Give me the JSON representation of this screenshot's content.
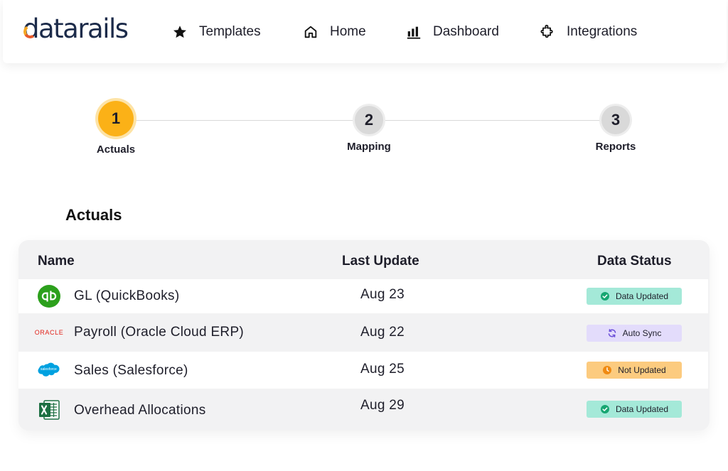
{
  "brand": {
    "logo_text": "datarails"
  },
  "nav": [
    {
      "label": "Templates",
      "icon": "star-icon"
    },
    {
      "label": "Home",
      "icon": "home-icon"
    },
    {
      "label": "Dashboard",
      "icon": "bar-chart-icon"
    },
    {
      "label": "Integrations",
      "icon": "puzzle-icon"
    }
  ],
  "stepper": [
    {
      "number": "1",
      "label": "Actuals",
      "state": "active"
    },
    {
      "number": "2",
      "label": "Mapping",
      "state": "pending"
    },
    {
      "number": "3",
      "label": "Reports",
      "state": "pending"
    }
  ],
  "section": {
    "title": "Actuals"
  },
  "table": {
    "headers": {
      "name": "Name",
      "last_update": "Last Update",
      "data_status": "Data Status"
    },
    "rows": [
      {
        "logo": "quickbooks-logo",
        "name": "GL (QuickBooks)",
        "last_update": "Aug 23",
        "status": "Data Updated",
        "status_color": "#a4e9d8",
        "status_icon": "check-circle-icon"
      },
      {
        "logo": "oracle-logo",
        "logo_text": "ORACLE",
        "name": "Payroll (Oracle Cloud ERP)",
        "last_update": "Aug 22",
        "status": "Auto Sync",
        "status_color": "#e3dcfb",
        "status_icon": "sync-icon"
      },
      {
        "logo": "salesforce-logo",
        "logo_text": "salesforce",
        "name": "Sales (Salesforce)",
        "last_update": "Aug 25",
        "status": "Not Updated",
        "status_color": "#fccb7f",
        "status_icon": "clock-icon"
      },
      {
        "logo": "excel-logo",
        "name": "Overhead Allocations",
        "last_update": "Aug 29",
        "status": "Data Updated",
        "status_color": "#a4e9d8",
        "status_icon": "check-circle-icon"
      }
    ]
  },
  "colors": {
    "accent": "#fbb117",
    "brand_navy": "#1c2b4a",
    "quickbooks_green": "#2ca01c",
    "oracle_red": "#e2231a",
    "salesforce_blue": "#00a1e0",
    "excel_green": "#1d6f42"
  }
}
